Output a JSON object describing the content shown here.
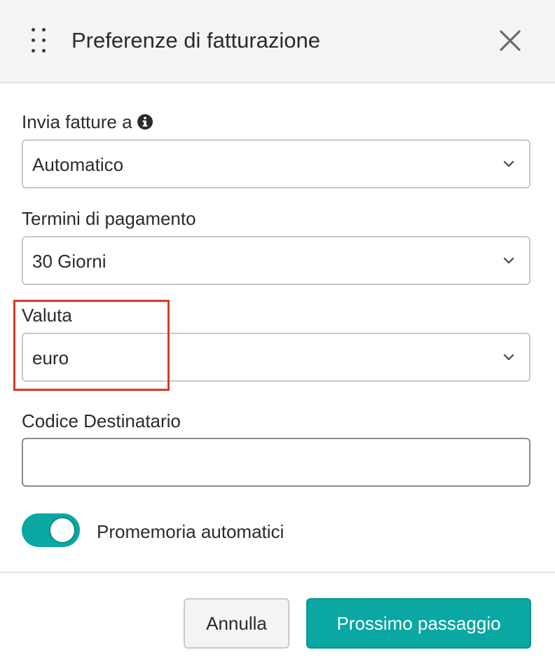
{
  "dialog": {
    "title": "Preferenze di fatturazione"
  },
  "fields": {
    "send_invoices": {
      "label": "Invia fatture a",
      "value": "Automatico"
    },
    "payment_terms": {
      "label": "Termini di pagamento",
      "value": "30 Giorni"
    },
    "currency": {
      "label": "Valuta",
      "value": "euro"
    },
    "recipient_code": {
      "label": "Codice Destinatario",
      "value": ""
    }
  },
  "toggle": {
    "label": "Promemoria automatici",
    "enabled": true
  },
  "footer": {
    "cancel_label": "Annulla",
    "next_label": "Prossimo passaggio"
  },
  "colors": {
    "accent": "#0aa7a3",
    "highlight": "#d93a25",
    "header_bg": "#f4f4f5"
  },
  "icons": {
    "drag": "drag-handle-icon",
    "close": "close-icon",
    "info": "info-icon",
    "chevron": "chevron-down-icon"
  }
}
